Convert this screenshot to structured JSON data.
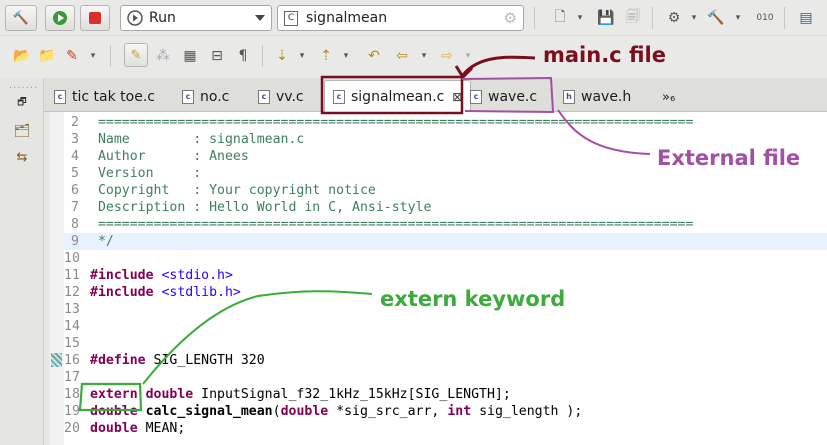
{
  "toolbar": {
    "run_label": "Run",
    "launch_config_label": "signalmean"
  },
  "tabs": [
    {
      "label": "tic tak toe.c",
      "icon": "c-file-icon"
    },
    {
      "label": "no.c",
      "icon": "c-file-icon"
    },
    {
      "label": "vv.c",
      "icon": "c-file-icon"
    },
    {
      "label": "signalmean.c",
      "icon": "c-file-icon",
      "active": true,
      "close": "⊠"
    },
    {
      "label": "wave.c",
      "icon": "c-file-icon"
    },
    {
      "label": "wave.h",
      "icon": "h-file-icon"
    },
    {
      "label": "»₆",
      "icon": "overflow-icon"
    }
  ],
  "code_lines": [
    {
      "n": "2",
      "text": " ==========================================================================="
    },
    {
      "n": "3",
      "text": " Name        : signalmean.c"
    },
    {
      "n": "4",
      "text": " Author      : Anees"
    },
    {
      "n": "5",
      "text": " Version     :"
    },
    {
      "n": "6",
      "text": " Copyright   : Your copyright notice"
    },
    {
      "n": "7",
      "text": " Description : Hello World in C, Ansi-style"
    },
    {
      "n": "8",
      "text": " ==========================================================================="
    },
    {
      "n": "9",
      "text": " */"
    },
    {
      "n": "10",
      "text": ""
    },
    {
      "n": "11",
      "kw": "#include",
      "rest": " <stdio.h>"
    },
    {
      "n": "12",
      "kw": "#include",
      "rest": " <stdlib.h>"
    },
    {
      "n": "13",
      "text": ""
    },
    {
      "n": "14",
      "text": ""
    },
    {
      "n": "15",
      "text": ""
    },
    {
      "n": "16",
      "kw": "#define",
      "code": " SIG_LENGTH 320"
    },
    {
      "n": "17",
      "text": ""
    },
    {
      "n": "18",
      "kw": "extern",
      "kw2": " double",
      "code": " InputSignal_f32_1kHz_15kHz[SIG_LENGTH];"
    },
    {
      "n": "19",
      "kw": "double",
      "fn": " calc_signal_mean",
      "code1": "(",
      "kw2": "double",
      "code2": " *sig_src_arr, ",
      "kw3": "int",
      "code3": " sig_length );"
    },
    {
      "n": "20",
      "kw": "double",
      "code": " MEAN;"
    }
  ],
  "annotations": {
    "main_file": "main.c file",
    "external_file": "External file",
    "extern_keyword": "extern keyword"
  },
  "colors": {
    "main_annotation": "#7a0d1f",
    "external_annotation": "#a24fa6",
    "extern_annotation": "#3bab3b",
    "keyword": "#7f0055",
    "comment": "#3f7f5f",
    "string": "#2a00ff"
  }
}
